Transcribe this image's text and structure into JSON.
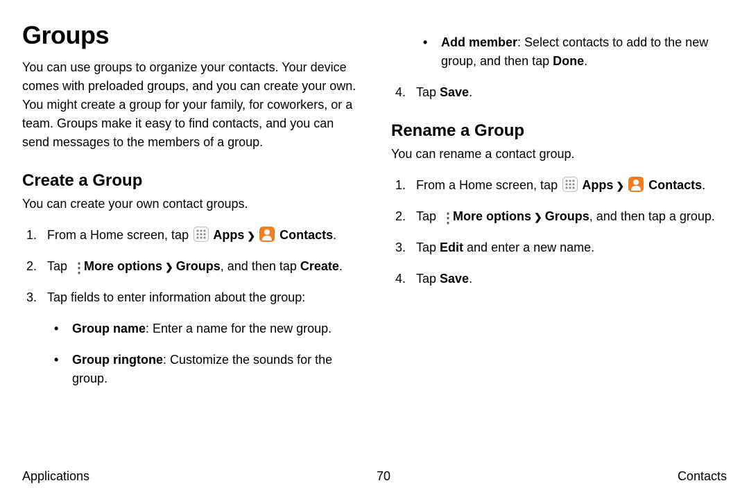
{
  "left": {
    "h1": "Groups",
    "intro": "You can use groups to organize your contacts. Your device comes with preloaded groups, and you can create your own. You might create a group for your family, for coworkers, or a team. Groups make it easy to find contacts, and you can send messages to the members of a group.",
    "h2": "Create a Group",
    "sub": "You can create your own contact groups.",
    "step1_a": "From a Home screen, tap ",
    "step1_apps": " Apps",
    "step1_contacts": " Contacts",
    "step1_end": ".",
    "step2_a": "Tap ",
    "step2_more": " More options",
    "step2_groups": "Groups",
    "step2_end": ", and then tap ",
    "step2_create": "Create",
    "step2_dot": ".",
    "step3": "Tap fields to enter information about the group:",
    "bul1_b": "Group name",
    "bul1_t": ": Enter a name for the new group.",
    "bul2_b": "Group ringtone",
    "bul2_t": ": Customize the sounds for the group."
  },
  "right": {
    "bul3_b": "Add member",
    "bul3_t1": ": Select contacts to add to the new group, and then tap ",
    "bul3_done": "Done",
    "bul3_dot": ".",
    "step4_a": "Tap ",
    "step4_save": "Save",
    "step4_dot": ".",
    "h2": "Rename a Group",
    "sub": "You can rename a contact group.",
    "r1_a": "From a Home screen, tap ",
    "r1_apps": " Apps",
    "r1_contacts": " Contacts",
    "r1_end": ".",
    "r2_a": "Tap ",
    "r2_more": " More options",
    "r2_groups": "Groups",
    "r2_end": ", and then tap a group.",
    "r3_a": "Tap ",
    "r3_edit": "Edit",
    "r3_end": " and enter a new name.",
    "r4_a": "Tap ",
    "r4_save": "Save",
    "r4_dot": "."
  },
  "footer": {
    "left": "Applications",
    "center": "70",
    "right": "Contacts"
  }
}
